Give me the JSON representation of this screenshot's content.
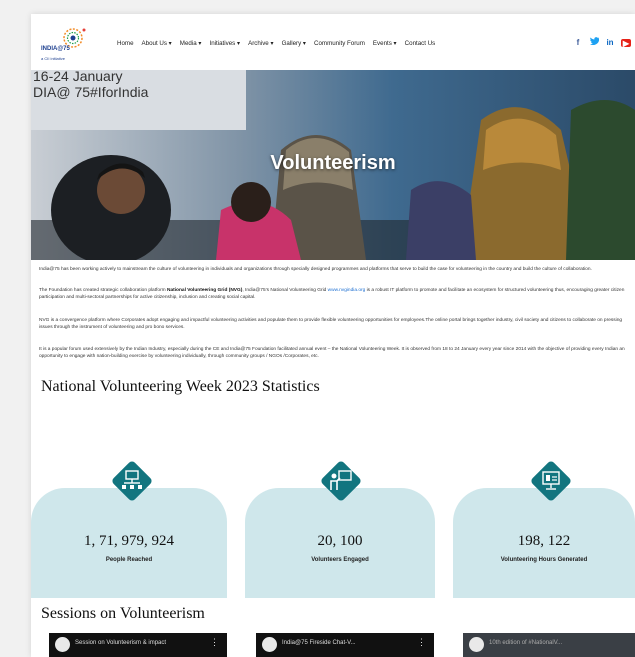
{
  "logo": {
    "brand": "INDIA@75",
    "tagline": "a CII initiative"
  },
  "nav": {
    "items": [
      "Home",
      "About Us ▾",
      "Media ▾",
      "Initiatives ▾",
      "Archive ▾",
      "Gallery ▾",
      "Community Forum",
      "Events ▾",
      "Contact Us"
    ]
  },
  "social": {
    "facebook": "f",
    "twitter": "t",
    "linkedin": "in",
    "youtube": "▶"
  },
  "hero": {
    "title": "Volunteerism",
    "board_line1": "16-24 January",
    "board_line2": "DIA@ 75#IforIndia"
  },
  "paragraphs": {
    "p1": "India@75 has been working actively to mainstream the culture of volunteering in individuals and organizations through specially designed programmes and platforms that serve to build the case for volunteering in the country and build the culture of collaboration.",
    "p2_a": "The Foundation has created strategic collaboration platform ",
    "p2_bold": "National Volunteering Grid (NVG)",
    "p2_b": ", India@75’s National Volunteering Grid ",
    "p2_link": "www.nvgindia.org",
    "p2_c": " is a robust IT platform to promote and facilitate an ecosystem for structured volunteering thus, encouraging greater citizen participation and multi-sectoral partnerships for active citizenship, inclusion and creating social capital.",
    "p3": "NVG is a convergence platform where Corporates adopt engaging and impactful volunteering activities and populate them to provide flexible volunteering opportunities for employees.The online portal brings together industry, civil society and citizens to collaborate on pressing issues through the instrument of volunteering and pro bono services.",
    "p4": "It is a popular forum used extensively by the Indian Industry, especially during the CE and India@75 Foundation facilitated annual event – the National Volunteering Week. It is observed from 18 to 24 January every year since 2014 with the objective of providing every Indian an opportunity to engage with nation-building exercise by volunteering individually, through community groups / NGOs /Corporates, etc."
  },
  "stats": {
    "heading": "National Volunteering Week 2023 Statistics",
    "items": [
      {
        "value": "1, 71, 979, 924",
        "label": "People Reached",
        "icon": "network-icon"
      },
      {
        "value": "20, 100",
        "label": "Volunteers Engaged",
        "icon": "presenter-icon"
      },
      {
        "value": "198, 122",
        "label": "Volunteering Hours Generated",
        "icon": "presentation-screen-icon"
      }
    ]
  },
  "sessions": {
    "heading": "Sessions on Volunteerism",
    "videos": [
      {
        "title": "Session on Volunteerism & impact"
      },
      {
        "title": "India@75 Fireside Chat-V..."
      },
      {
        "title": "10th edition of #NationalV..."
      }
    ]
  },
  "colors": {
    "teal": "#12757f",
    "card": "#cfe7eb",
    "link": "#1d6fd1"
  }
}
